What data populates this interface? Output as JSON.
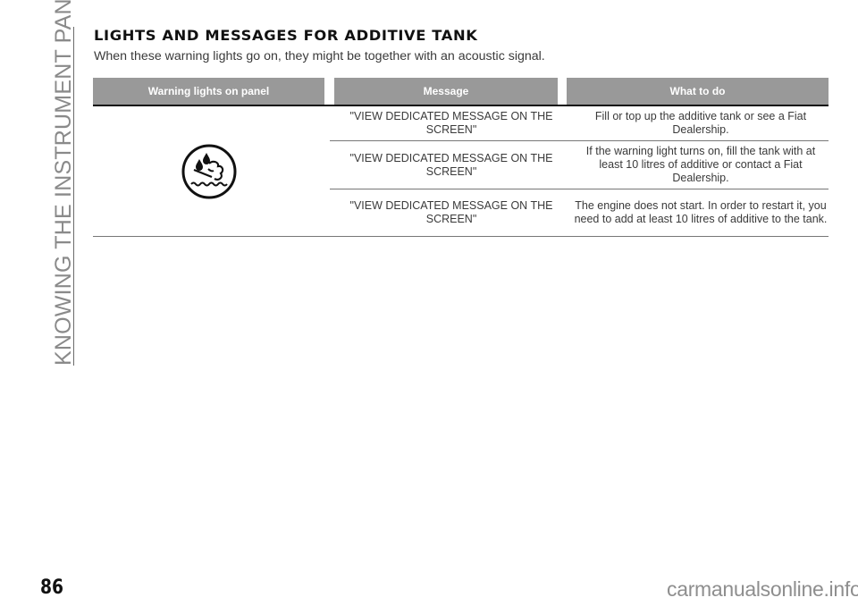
{
  "sidebar": {
    "section_label": "KNOWING THE INSTRUMENT PANEL"
  },
  "section": {
    "title": "LIGHTS AND MESSAGES FOR ADDITIVE TANK",
    "intro": "When these warning lights go on, they might be together with an acoustic signal."
  },
  "table": {
    "headers": [
      "Warning lights on panel",
      "Message",
      "What to do"
    ],
    "header_bg": "#999999",
    "warning_icon": "additive-tank-warning-icon",
    "rows": [
      {
        "message": "\"VIEW DEDICATED MESSAGE ON THE SCREEN\"",
        "action": "Fill or top up the additive tank or see a Fiat Dealership."
      },
      {
        "message": "\"VIEW DEDICATED MESSAGE ON THE SCREEN\"",
        "action": "If the warning light turns on, fill the tank with at least 10 litres of additive or contact a Fiat Dealership."
      },
      {
        "message": "\"VIEW DEDICATED MESSAGE ON THE SCREEN\"",
        "action": "The engine does not start. In order to restart it, you need to add at least 10 litres of additive to the tank."
      }
    ]
  },
  "footer": {
    "page_number": "86",
    "watermark": "carmanualsonline.info"
  }
}
